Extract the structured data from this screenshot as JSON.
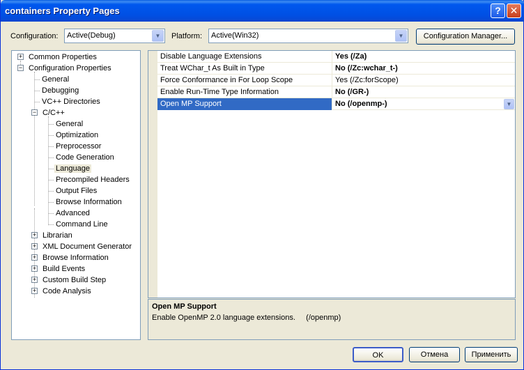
{
  "window": {
    "title": "containers Property Pages"
  },
  "titlebar": {
    "help_glyph": "?",
    "close_glyph": "✕"
  },
  "config": {
    "configuration_label": "Configuration:",
    "configuration_value": "Active(Debug)",
    "platform_label": "Platform:",
    "platform_value": "Active(Win32)",
    "manager_button": "Configuration Manager..."
  },
  "tree": {
    "common_properties": "Common Properties",
    "configuration_properties": "Configuration Properties",
    "general": "General",
    "debugging": "Debugging",
    "vc_directories": "VC++ Directories",
    "cpp": "C/C++",
    "cpp_general": "General",
    "optimization": "Optimization",
    "preprocessor": "Preprocessor",
    "code_generation": "Code Generation",
    "language": "Language",
    "precompiled_headers": "Precompiled Headers",
    "output_files": "Output Files",
    "browse_information": "Browse Information",
    "advanced": "Advanced",
    "command_line": "Command Line",
    "librarian": "Librarian",
    "xml_doc_generator": "XML Document Generator",
    "browse_information2": "Browse Information",
    "build_events": "Build Events",
    "custom_build_step": "Custom Build Step",
    "code_analysis": "Code Analysis"
  },
  "properties": [
    {
      "name": "Disable Language Extensions",
      "value": "Yes (/Za)"
    },
    {
      "name": "Treat WChar_t As Built in Type",
      "value": "No (/Zc:wchar_t-)"
    },
    {
      "name": "Force Conformance in For Loop Scope",
      "value": "Yes (/Zc:forScope)"
    },
    {
      "name": "Enable Run-Time Type Information",
      "value": "No (/GR-)"
    },
    {
      "name": "Open MP Support",
      "value": "No (/openmp-)"
    }
  ],
  "description": {
    "title": "Open MP Support",
    "text": "Enable OpenMP 2.0 language extensions.     (/openmp)"
  },
  "buttons": {
    "ok": "OK",
    "cancel": "Отмена",
    "apply": "Применить"
  },
  "colors": {
    "titlebar": "#0054e3",
    "selection": "#316ac5",
    "face": "#ece9d8"
  }
}
